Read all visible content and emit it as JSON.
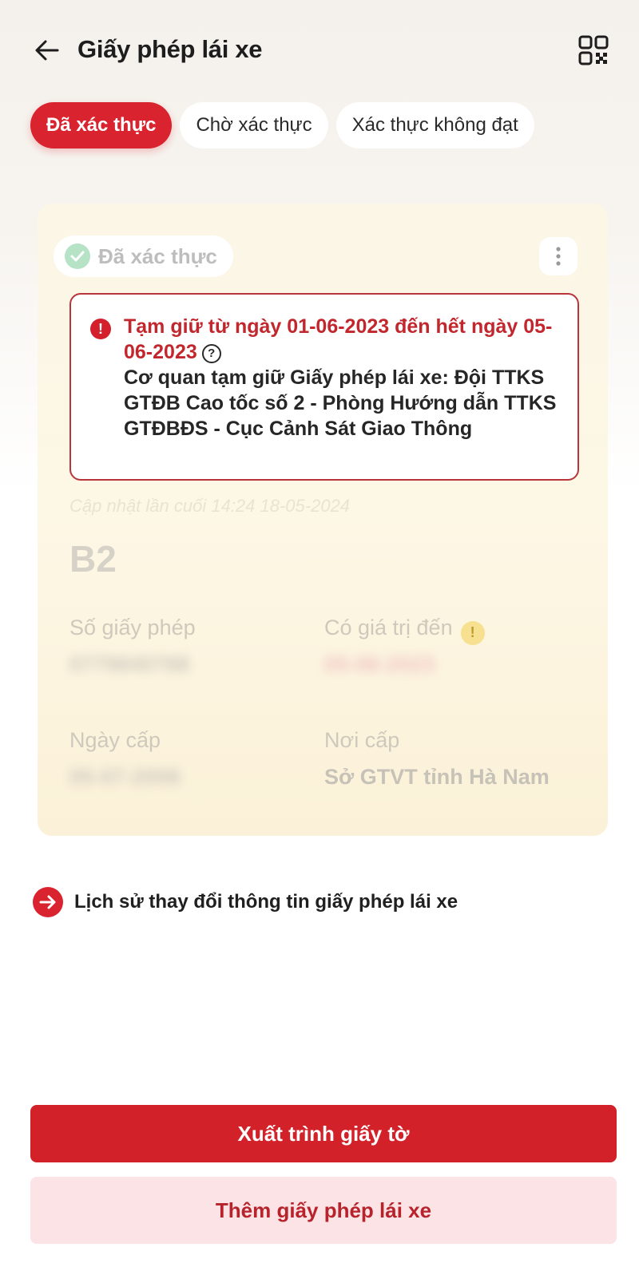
{
  "header": {
    "title": "Giấy phép lái xe",
    "back_icon": "arrow-left-icon",
    "qr_icon": "qr-code-icon"
  },
  "tabs": [
    {
      "label": "Đã xác thực",
      "active": true
    },
    {
      "label": "Chờ xác thực",
      "active": false
    },
    {
      "label": "Xác thực không đạt",
      "active": false
    }
  ],
  "card": {
    "status_label": "Đã xác thực",
    "alert": {
      "title": "Tạm giữ từ ngày 01-06-2023 đến hết ngày 05-06-2023",
      "body": "Cơ quan tạm giữ Giấy phép lái xe: Đội TTKS GTĐB Cao tốc số 2 - Phòng Hướng dẫn TTKS GTĐBĐS - Cục Cảnh Sát Giao Thông"
    },
    "last_updated": "Cập nhật lần cuối 14:24 18-05-2024",
    "license_class": "B2",
    "fields": {
      "license_number_label": "Số giấy phép",
      "license_number_value": "0779840788",
      "valid_until_label": "Có giá trị đến",
      "valid_until_value": "05-06-2023",
      "issue_date_label": "Ngày cấp",
      "issue_date_value": "05-07-2008",
      "issuer_label": "Nơi cấp",
      "issuer_value": "Sở GTVT tỉnh Hà Nam"
    }
  },
  "history_link": "Lịch sử thay đổi thông tin giấy phép lái xe",
  "buttons": {
    "primary": "Xuất trình giấy tờ",
    "secondary": "Thêm giấy phép lái xe"
  },
  "colors": {
    "brand_red": "#d9232e",
    "alert_border": "#b8353b",
    "secondary_bg": "#fbe3e6",
    "card_bg": "#fbf6e6"
  }
}
